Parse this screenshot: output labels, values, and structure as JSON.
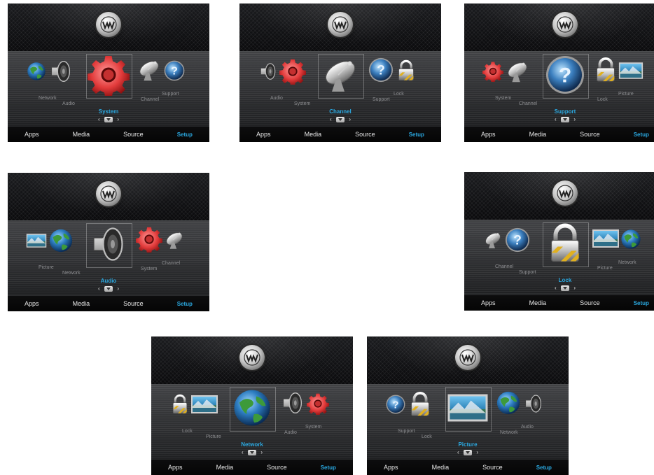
{
  "nav": {
    "apps": "Apps",
    "media": "Media",
    "source": "Source",
    "setup": "Setup"
  },
  "colors": {
    "accent": "#2aa8e0",
    "label": "#8e8f92",
    "nav": "#e8e8e8"
  },
  "logo_icon": "w-logo-icon",
  "screens": [
    {
      "id": "system",
      "selected": "System",
      "left": [
        "Network",
        "Audio"
      ],
      "right": [
        "Channel",
        "Support"
      ]
    },
    {
      "id": "channel",
      "selected": "Channel",
      "left": [
        "Audio",
        "System"
      ],
      "right": [
        "Support",
        "Lock"
      ]
    },
    {
      "id": "support",
      "selected": "Support",
      "left": [
        "System",
        "Channel"
      ],
      "right": [
        "Lock",
        "Picture"
      ]
    },
    {
      "id": "audio",
      "selected": "Audio",
      "left": [
        "Picture",
        "Network"
      ],
      "right": [
        "System",
        "Channel"
      ]
    },
    {
      "id": "lock",
      "selected": "Lock",
      "left": [
        "Channel",
        "Support"
      ],
      "right": [
        "Picture",
        "Network"
      ]
    },
    {
      "id": "network",
      "selected": "Network",
      "left": [
        "Lock",
        "Picture"
      ],
      "right": [
        "Audio",
        "System"
      ]
    },
    {
      "id": "picture",
      "selected": "Picture",
      "left": [
        "Support",
        "Lock"
      ],
      "right": [
        "Network",
        "Audio"
      ]
    }
  ]
}
